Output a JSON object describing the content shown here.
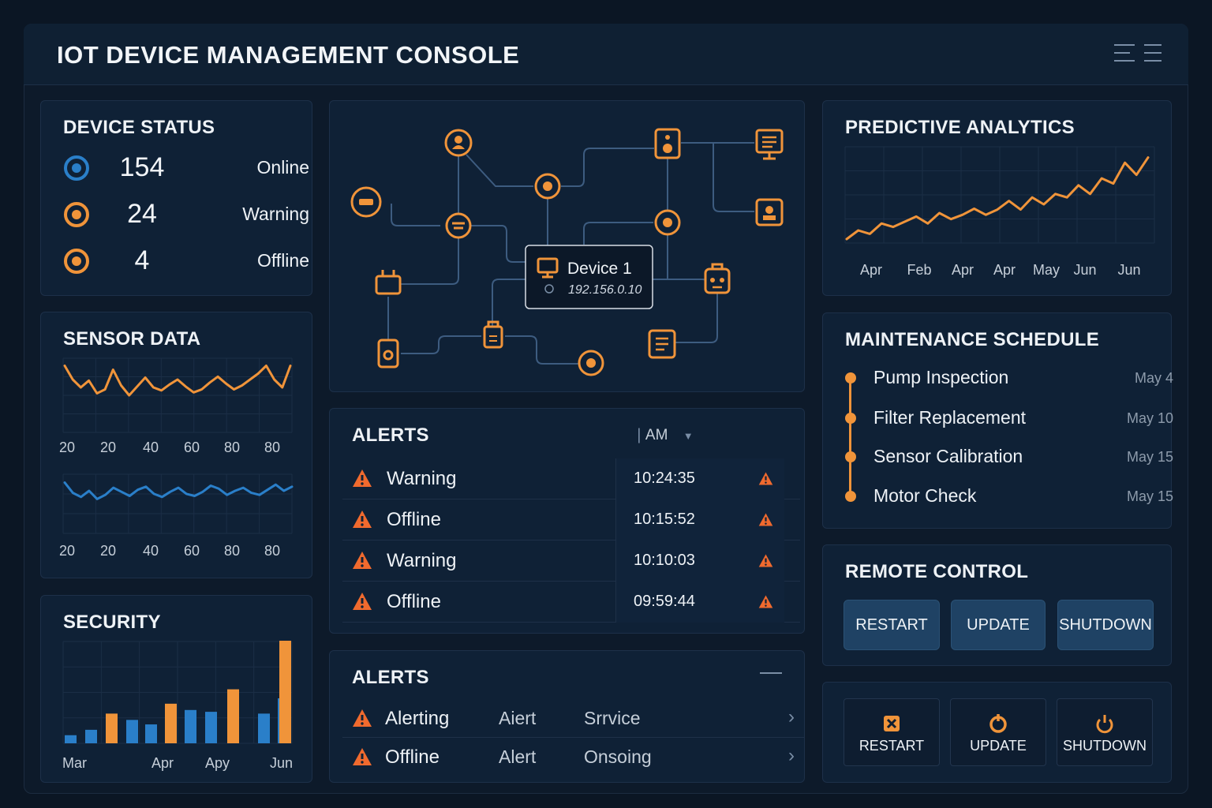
{
  "app": {
    "title": "IOT DEVICE MANAGEMENT CONSOLE"
  },
  "colors": {
    "accent": "#f0943a",
    "blue": "#2a7fc9",
    "alert": "#f06a2e",
    "panel": "#0f2136"
  },
  "device_status": {
    "title": "DEVICE STATUS",
    "rows": [
      {
        "count": "154",
        "label": "Online",
        "color": "#2a7fc9"
      },
      {
        "count": "24",
        "label": "Warning",
        "color": "#f0943a"
      },
      {
        "count": "4",
        "label": "Offline",
        "color": "#f0943a"
      }
    ]
  },
  "sensor_data": {
    "title": "SENSOR DATA",
    "ticks_top": [
      "20",
      "20",
      "40",
      "60",
      "80",
      "80"
    ],
    "ticks_bottom": [
      "20",
      "20",
      "40",
      "60",
      "80",
      "80"
    ]
  },
  "security": {
    "title": "SECURITY",
    "xlabels": [
      "Mar",
      "Apr",
      "Apy",
      "Jun"
    ]
  },
  "network": {
    "tooltip_name": "Device 1",
    "tooltip_ip": "192.156.0.10"
  },
  "alerts": {
    "title": "ALERTS",
    "filter": "AM",
    "rows": [
      {
        "label": "Warning",
        "time": "10:24:35"
      },
      {
        "label": "Offline",
        "time": "10:15:52"
      },
      {
        "label": "Warning",
        "time": "10:10:03"
      },
      {
        "label": "Offline",
        "time": "09:59:44"
      }
    ]
  },
  "alerts2": {
    "title": "ALERTS",
    "rows": [
      {
        "c1": "Alerting",
        "c2": "Aiert",
        "c3": "Srrvice"
      },
      {
        "c1": "Offline",
        "c2": "Alert",
        "c3": "Onsoing"
      }
    ]
  },
  "predictive": {
    "title": "PREDICTIVE ANALYTICS",
    "xlabels": [
      "Apr",
      "Feb",
      "Apr",
      "Apr",
      "May",
      "Jun",
      "Jun"
    ]
  },
  "maintenance": {
    "title": "MAINTENANCE SCHEDULE",
    "items": [
      {
        "label": "Pump Inspection",
        "date": "May 4"
      },
      {
        "label": "Filter Replacement",
        "date": "May 10"
      },
      {
        "label": "Sensor Calibration",
        "date": "May 15"
      },
      {
        "label": "Motor Check",
        "date": "May 15"
      }
    ]
  },
  "remote_control": {
    "title": "REMOTE CONTROL",
    "buttons": [
      "RESTART",
      "UPDATE",
      "SHUTDOWN"
    ]
  },
  "quick_actions": {
    "buttons": [
      {
        "label": "RESTART",
        "icon": "restart-icon"
      },
      {
        "label": "UPDATE",
        "icon": "update-icon"
      },
      {
        "label": "SHUTDOWN",
        "icon": "power-icon"
      }
    ]
  },
  "chart_data": [
    {
      "type": "line",
      "title": "SENSOR DATA",
      "x": [
        1,
        2,
        3,
        4,
        5,
        6,
        7,
        8,
        9,
        10,
        11,
        12,
        13,
        14,
        15,
        16,
        17,
        18,
        19,
        20,
        21,
        22,
        23,
        24,
        25,
        26,
        27,
        28,
        29
      ],
      "series": [
        {
          "values": [
            74,
            60,
            52,
            59,
            46,
            50,
            70,
            54,
            44,
            53,
            62,
            52,
            49,
            55,
            60,
            53,
            47,
            50,
            57,
            63,
            56,
            50,
            54,
            60,
            66,
            74,
            60,
            52,
            74
          ]
        },
        {
          "values": [
            38,
            28,
            24,
            30,
            22,
            26,
            33,
            29,
            25,
            31,
            34,
            27,
            24,
            29,
            33,
            27,
            25,
            29,
            35,
            32,
            26,
            30,
            33,
            28,
            26,
            31,
            36,
            30,
            34
          ]
        }
      ]
    },
    {
      "type": "bar",
      "title": "SECURITY",
      "series": [
        {
          "values": [
            18,
            30,
            52,
            66,
            42,
            74,
            70,
            60,
            88,
            120,
            66,
            100,
            112,
            134,
            180,
            210,
            126,
            228
          ]
        }
      ]
    },
    {
      "type": "line",
      "title": "PREDICTIVE ANALYTICS",
      "x": [
        1,
        2,
        3,
        4,
        5,
        6,
        7,
        8,
        9,
        10,
        11,
        12,
        13,
        14,
        15,
        16,
        17,
        18,
        19,
        20,
        21,
        22,
        23,
        24,
        25,
        26,
        27
      ],
      "series": [
        {
          "values": [
            10,
            20,
            16,
            28,
            24,
            30,
            36,
            28,
            40,
            33,
            38,
            45,
            38,
            44,
            54,
            44,
            58,
            50,
            62,
            58,
            72,
            62,
            80,
            74,
            98,
            84,
            104
          ]
        }
      ]
    }
  ]
}
